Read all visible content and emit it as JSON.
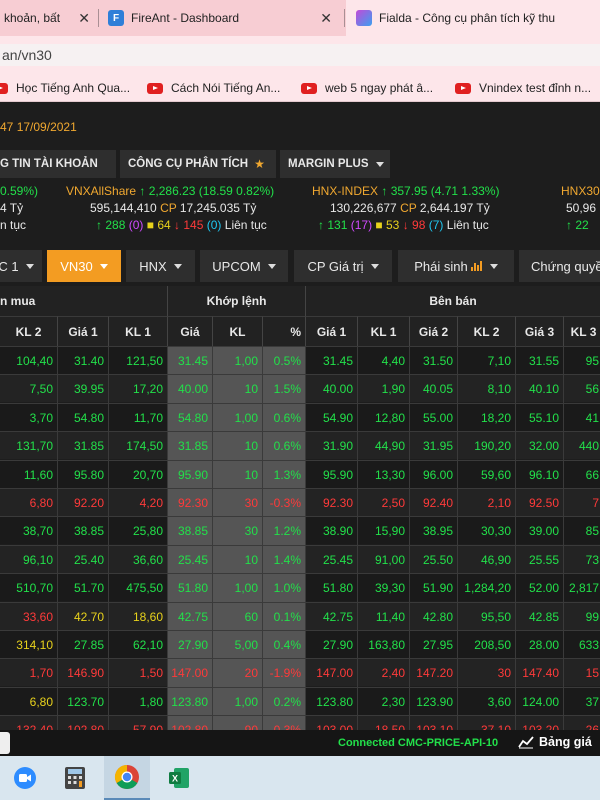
{
  "browser": {
    "tabs": [
      {
        "title": "khoản, bất",
        "favicon": ""
      },
      {
        "title": "FireAnt - Dashboard",
        "favicon": "F"
      },
      {
        "title": "Fialda - Công cụ phân tích kỹ thu",
        "favicon": ""
      }
    ],
    "url": "an/vn30",
    "bookmarks": [
      "Học Tiếng Anh Qua...",
      "Cách Nói Tiếng An...",
      "web 5 ngay phát â...",
      "Vnindex test đỉnh n..."
    ]
  },
  "header": {
    "time_prefix": "47",
    "date": "17/09/2021"
  },
  "menu": {
    "account": "G TIN TÀI KHOẢN",
    "tools": "CÔNG CỤ PHÂN TÍCH",
    "margin": "MARGIN PLUS"
  },
  "indices": {
    "left": {
      "change_pct": "0.59%)",
      "value": "4 Tỷ",
      "status": "n tục"
    },
    "vnxall": {
      "name": "VNXAllShare",
      "value": "2,286.23",
      "change": "(18.59 0.82%)",
      "volume": "595,144,410",
      "cp_label": "CP",
      "turnover": "17,245.035 Tỷ",
      "up": "288",
      "ref": "(0)",
      "ceil": "64",
      "down": "145",
      "floor": "(0)",
      "status": "Liên tục"
    },
    "hnx": {
      "name": "HNX-INDEX",
      "value": "357.95",
      "change": "(4.71 1.33%)",
      "volume": "130,226,677",
      "cp_label": "CP",
      "turnover": "2,644.197 Tỷ",
      "up": "131",
      "ref": "(17)",
      "ceil": "53",
      "down": "98",
      "floor": "(7)",
      "status": "Liên tục"
    },
    "hnx30": {
      "name": "HNX30",
      "volume": "50,96",
      "up": "22"
    }
  },
  "market_tabs": [
    "C 1",
    "VN30",
    "HNX",
    "UPCOM",
    "CP Giá trị",
    "Phái sinh",
    "Chứng quyề"
  ],
  "table": {
    "groups": {
      "buy": "n mua",
      "match": "Khớp lệnh",
      "sell": "Bên bán"
    },
    "columns": [
      "KL 2",
      "Giá 1",
      "KL 1",
      "Giá",
      "KL",
      "%",
      "Giá 1",
      "KL 1",
      "Giá 2",
      "KL 2",
      "Giá 3",
      "KL 3"
    ],
    "rows": [
      {
        "c": [
          "104,40",
          "31.40",
          "121,50",
          "31.45",
          "1,00",
          "0.5%",
          "31.45",
          "4,40",
          "31.50",
          "7,10",
          "31.55",
          "95"
        ],
        "col": [
          "g",
          "g",
          "g",
          "g",
          "g",
          "g",
          "g",
          "g",
          "g",
          "g",
          "g",
          "g"
        ]
      },
      {
        "c": [
          "7,50",
          "39.95",
          "17,20",
          "40.00",
          "10",
          "1.5%",
          "40.00",
          "1,90",
          "40.05",
          "8,10",
          "40.10",
          "56"
        ],
        "col": [
          "g",
          "g",
          "g",
          "g",
          "g",
          "g",
          "g",
          "g",
          "g",
          "g",
          "g",
          "g"
        ]
      },
      {
        "c": [
          "3,70",
          "54.80",
          "11,70",
          "54.80",
          "1,00",
          "0.6%",
          "54.90",
          "12,80",
          "55.00",
          "18,20",
          "55.10",
          "41"
        ],
        "col": [
          "g",
          "g",
          "g",
          "g",
          "g",
          "g",
          "g",
          "g",
          "g",
          "g",
          "g",
          "g"
        ]
      },
      {
        "c": [
          "131,70",
          "31.85",
          "174,50",
          "31.85",
          "10",
          "0.6%",
          "31.90",
          "44,90",
          "31.95",
          "190,20",
          "32.00",
          "440"
        ],
        "col": [
          "g",
          "g",
          "g",
          "g",
          "g",
          "g",
          "g",
          "g",
          "g",
          "g",
          "g",
          "g"
        ]
      },
      {
        "c": [
          "11,60",
          "95.80",
          "20,70",
          "95.90",
          "10",
          "1.3%",
          "95.90",
          "13,30",
          "96.00",
          "59,60",
          "96.10",
          "66"
        ],
        "col": [
          "g",
          "g",
          "g",
          "g",
          "g",
          "g",
          "g",
          "g",
          "g",
          "g",
          "g",
          "g"
        ]
      },
      {
        "c": [
          "6,80",
          "92.20",
          "4,20",
          "92.30",
          "30",
          "-0.3%",
          "92.30",
          "2,50",
          "92.40",
          "2,10",
          "92.50",
          "7"
        ],
        "col": [
          "r",
          "r",
          "r",
          "r",
          "r",
          "r",
          "r",
          "r",
          "r",
          "r",
          "r",
          "r"
        ]
      },
      {
        "c": [
          "38,70",
          "38.85",
          "25,80",
          "38.85",
          "30",
          "1.2%",
          "38.90",
          "15,90",
          "38.95",
          "30,30",
          "39.00",
          "85"
        ],
        "col": [
          "g",
          "g",
          "g",
          "g",
          "g",
          "g",
          "g",
          "g",
          "g",
          "g",
          "g",
          "g"
        ]
      },
      {
        "c": [
          "96,10",
          "25.40",
          "36,60",
          "25.45",
          "10",
          "1.4%",
          "25.45",
          "91,00",
          "25.50",
          "46,90",
          "25.55",
          "73"
        ],
        "col": [
          "g",
          "g",
          "g",
          "g",
          "g",
          "g",
          "g",
          "g",
          "g",
          "g",
          "g",
          "g"
        ]
      },
      {
        "c": [
          "510,70",
          "51.70",
          "475,50",
          "51.80",
          "1,00",
          "1.0%",
          "51.80",
          "39,30",
          "51.90",
          "1,284,20",
          "52.00",
          "2,817"
        ],
        "col": [
          "g",
          "g",
          "g",
          "g",
          "g",
          "g",
          "g",
          "g",
          "g",
          "g",
          "g",
          "g"
        ]
      },
      {
        "c": [
          "33,60",
          "42.70",
          "18,60",
          "42.75",
          "60",
          "0.1%",
          "42.75",
          "11,40",
          "42.80",
          "95,50",
          "42.85",
          "99"
        ],
        "col": [
          "r",
          "y",
          "y",
          "g",
          "g",
          "g",
          "g",
          "g",
          "g",
          "g",
          "g",
          "g"
        ]
      },
      {
        "c": [
          "314,10",
          "27.85",
          "62,10",
          "27.90",
          "5,00",
          "0.4%",
          "27.90",
          "163,80",
          "27.95",
          "208,50",
          "28.00",
          "633"
        ],
        "col": [
          "y",
          "g",
          "g",
          "g",
          "g",
          "g",
          "g",
          "g",
          "g",
          "g",
          "g",
          "g"
        ]
      },
      {
        "c": [
          "1,70",
          "146.90",
          "1,50",
          "147.00",
          "20",
          "-1.9%",
          "147.00",
          "2,40",
          "147.20",
          "30",
          "147.40",
          "15"
        ],
        "col": [
          "r",
          "r",
          "r",
          "r",
          "r",
          "r",
          "r",
          "r",
          "r",
          "r",
          "r",
          "r"
        ]
      },
      {
        "c": [
          "6,80",
          "123.70",
          "1,80",
          "123.80",
          "1,00",
          "0.2%",
          "123.80",
          "2,30",
          "123.90",
          "3,60",
          "124.00",
          "37"
        ],
        "col": [
          "y",
          "g",
          "g",
          "g",
          "g",
          "g",
          "g",
          "g",
          "g",
          "g",
          "g",
          "g"
        ]
      },
      {
        "c": [
          "132,40",
          "102.80",
          "57,90",
          "102.80",
          "90",
          "-0.3%",
          "103.00",
          "18,50",
          "103.10",
          "37,10",
          "103.20",
          "26"
        ],
        "col": [
          "r",
          "r",
          "r",
          "r",
          "r",
          "r",
          "r",
          "r",
          "r",
          "r",
          "r",
          "r"
        ]
      }
    ]
  },
  "status": {
    "connected": "Connected CMC-PRICE-API-10",
    "price_board": "Bảng giá"
  },
  "taskbar": [
    "zoom-icon",
    "calculator-icon",
    "chrome-icon",
    "excel-icon"
  ],
  "colors": {
    "accent": "#f39c22",
    "up": "#22e04a",
    "down": "#ff3a3a",
    "ref": "#e8d21c"
  }
}
